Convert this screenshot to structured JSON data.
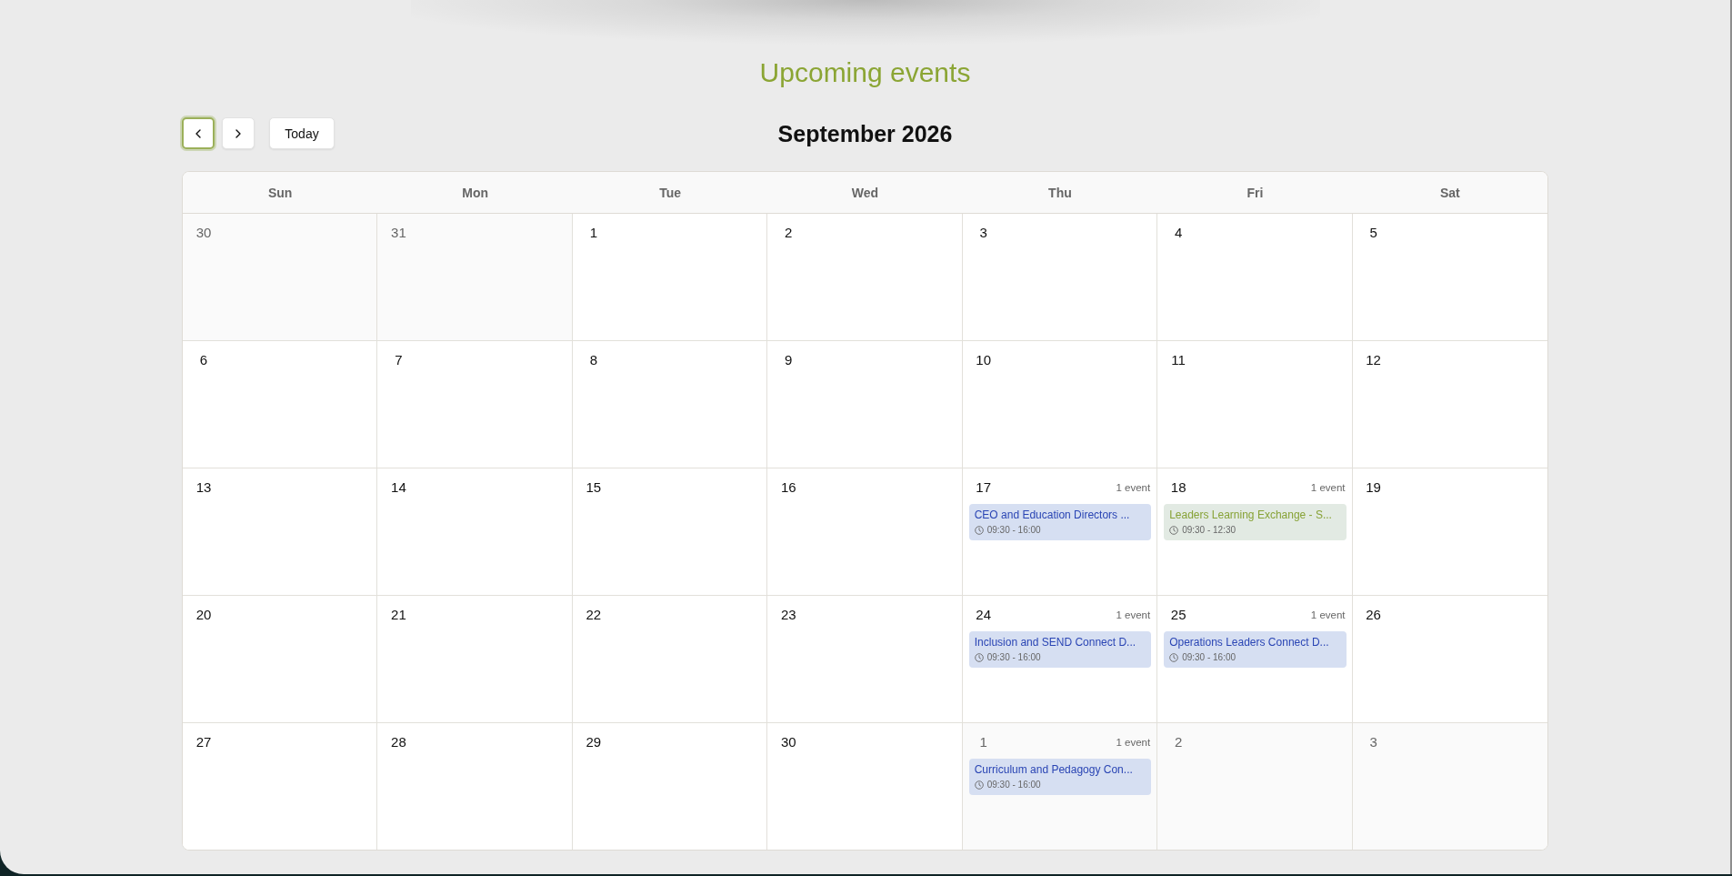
{
  "title": "Upcoming events",
  "toolbar": {
    "buttons": [
      {
        "kind": "previous",
        "focused": true
      },
      {
        "kind": "next",
        "focused": false
      },
      {
        "kind": "label",
        "label": "Today",
        "focused": false
      }
    ],
    "month": "September 2026"
  },
  "calendar": {
    "weekdays": [
      "Sun",
      "Mon",
      "Tue",
      "Wed",
      "Thu",
      "Fri",
      "Sat"
    ],
    "weeks": [
      [
        {
          "day": "30",
          "in_month": false
        },
        {
          "day": "31",
          "in_month": false
        },
        {
          "day": "1",
          "in_month": true
        },
        {
          "day": "2",
          "in_month": true
        },
        {
          "day": "3",
          "in_month": true
        },
        {
          "day": "4",
          "in_month": true
        },
        {
          "day": "5",
          "in_month": true
        }
      ],
      [
        {
          "day": "6",
          "in_month": true
        },
        {
          "day": "7",
          "in_month": true
        },
        {
          "day": "8",
          "in_month": true
        },
        {
          "day": "9",
          "in_month": true
        },
        {
          "day": "10",
          "in_month": true
        },
        {
          "day": "11",
          "in_month": true
        },
        {
          "day": "12",
          "in_month": true
        }
      ],
      [
        {
          "day": "13",
          "in_month": true
        },
        {
          "day": "14",
          "in_month": true
        },
        {
          "day": "15",
          "in_month": true
        },
        {
          "day": "16",
          "in_month": true
        },
        {
          "day": "17",
          "in_month": true,
          "count": "1 event",
          "events": [
            {
              "title": "CEO and Education Directors ...",
              "time": "09:30 - 16:00",
              "color": "#2a45b4"
            }
          ]
        },
        {
          "day": "18",
          "in_month": true,
          "count": "1 event",
          "events": [
            {
              "title": "Leaders Learning Exchange - S...",
              "time": "09:30 - 12:30",
              "color": "#87a236"
            }
          ]
        },
        {
          "day": "19",
          "in_month": true
        }
      ],
      [
        {
          "day": "20",
          "in_month": true
        },
        {
          "day": "21",
          "in_month": true
        },
        {
          "day": "22",
          "in_month": true
        },
        {
          "day": "23",
          "in_month": true
        },
        {
          "day": "24",
          "in_month": true,
          "count": "1 event",
          "events": [
            {
              "title": "Inclusion and SEND Connect D...",
              "time": "09:30 - 16:00",
              "color": "#2a45b4"
            }
          ]
        },
        {
          "day": "25",
          "in_month": true,
          "count": "1 event",
          "events": [
            {
              "title": "Operations Leaders Connect D...",
              "time": "09:30 - 16:00",
              "color": "#2a45b4"
            }
          ]
        },
        {
          "day": "26",
          "in_month": true
        }
      ],
      [
        {
          "day": "27",
          "in_month": true
        },
        {
          "day": "28",
          "in_month": true
        },
        {
          "day": "29",
          "in_month": true
        },
        {
          "day": "30",
          "in_month": true
        },
        {
          "day": "1",
          "in_month": false,
          "count": "1 event",
          "events": [
            {
              "title": "Curriculum and Pedagogy Con...",
              "time": "09:30 - 16:00",
              "color": "#2a45b4"
            }
          ]
        },
        {
          "day": "2",
          "in_month": false
        },
        {
          "day": "3",
          "in_month": false
        }
      ]
    ]
  }
}
